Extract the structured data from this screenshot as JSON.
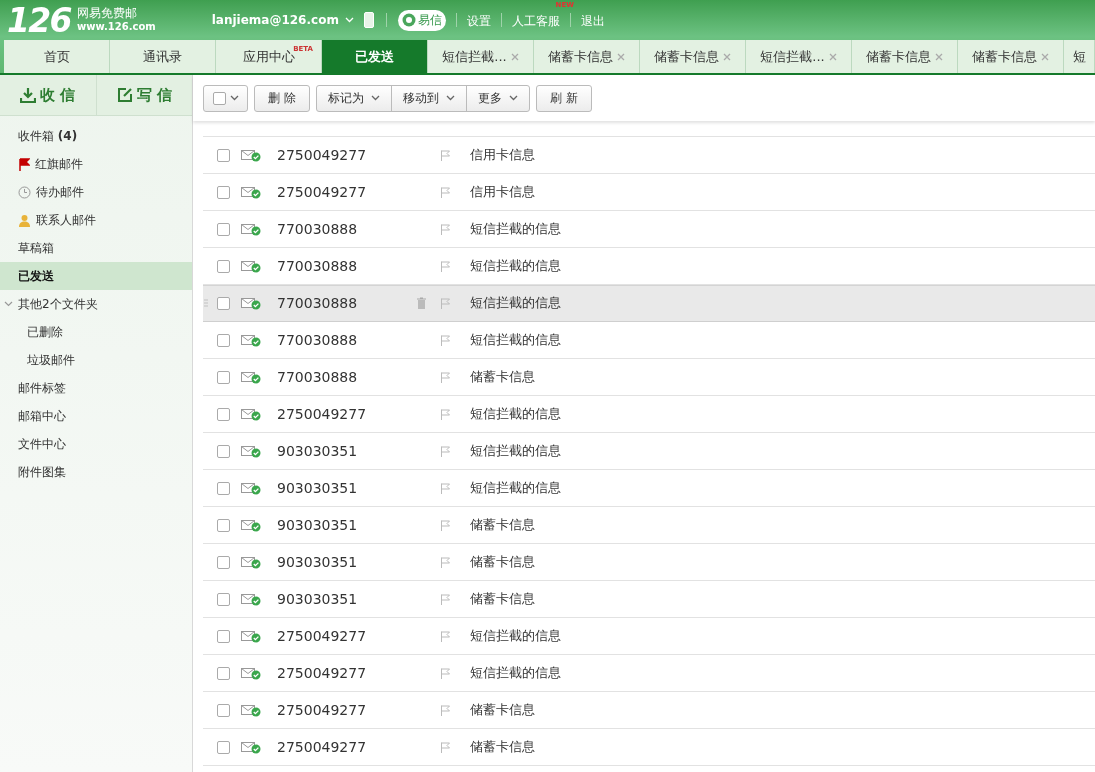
{
  "header": {
    "logo": "126",
    "brand": "网易免费邮",
    "site": "www.126.com",
    "account": "lanjiema@126.com",
    "yixin": "易信",
    "links": [
      {
        "label": "设置"
      },
      {
        "label": "人工客服",
        "badge": "NEW"
      },
      {
        "label": "退出"
      }
    ]
  },
  "tabs": [
    {
      "label": "首页",
      "closable": false,
      "selected": false
    },
    {
      "label": "通讯录",
      "closable": false,
      "selected": false
    },
    {
      "label": "应用中心",
      "badge": "BETA",
      "closable": false,
      "selected": false
    },
    {
      "label": "已发送",
      "closable": false,
      "selected": true
    },
    {
      "label": "短信拦截...",
      "closable": true,
      "selected": false
    },
    {
      "label": "储蓄卡信息",
      "closable": true,
      "selected": false
    },
    {
      "label": "储蓄卡信息",
      "closable": true,
      "selected": false
    },
    {
      "label": "短信拦截...",
      "closable": true,
      "selected": false
    },
    {
      "label": "储蓄卡信息",
      "closable": true,
      "selected": false
    },
    {
      "label": "储蓄卡信息",
      "closable": true,
      "selected": false
    },
    {
      "label": "短",
      "closable": false,
      "selected": false
    }
  ],
  "actions": {
    "receive": "收 信",
    "compose": "写 信"
  },
  "sidebar": {
    "items": [
      {
        "label": "收件箱 **(4)**",
        "kind": "plain",
        "selected": false
      },
      {
        "label": "红旗邮件",
        "kind": "flag",
        "selected": false
      },
      {
        "label": "待办邮件",
        "kind": "clock",
        "selected": false
      },
      {
        "label": "联系人邮件",
        "kind": "contact",
        "selected": false
      },
      {
        "label": "草稿箱",
        "kind": "plain",
        "selected": false
      },
      {
        "label": "已发送",
        "kind": "plain",
        "selected": true
      },
      {
        "label": "其他2个文件夹",
        "kind": "group",
        "selected": false,
        "expanded": true,
        "children": [
          {
            "label": "已删除",
            "selected": false
          },
          {
            "label": "垃圾邮件",
            "selected": false
          }
        ]
      },
      {
        "label": "邮件标签",
        "kind": "plain",
        "selected": false
      },
      {
        "label": "邮箱中心",
        "kind": "plain",
        "selected": false
      },
      {
        "label": "文件中心",
        "kind": "plain",
        "selected": false
      },
      {
        "label": "附件图集",
        "kind": "plain",
        "selected": false
      }
    ]
  },
  "toolbar": [
    {
      "label": "删 除",
      "kind": "button"
    },
    {
      "label": "标记为",
      "kind": "dropdown"
    },
    {
      "label": "移动到",
      "kind": "dropdown"
    },
    {
      "label": "更多",
      "kind": "dropdown"
    },
    {
      "label": "刷 新",
      "kind": "button"
    }
  ],
  "rows": [
    {
      "sender": "2750049277",
      "subject": "信用卡信息",
      "checked": false,
      "hovered": false
    },
    {
      "sender": "2750049277",
      "subject": "信用卡信息",
      "checked": false,
      "hovered": false
    },
    {
      "sender": "770030888",
      "subject": "短信拦截的信息",
      "checked": false,
      "hovered": false
    },
    {
      "sender": "770030888",
      "subject": "短信拦截的信息",
      "checked": false,
      "hovered": false
    },
    {
      "sender": "770030888",
      "subject": "短信拦截的信息",
      "checked": false,
      "hovered": true
    },
    {
      "sender": "770030888",
      "subject": "短信拦截的信息",
      "checked": false,
      "hovered": false
    },
    {
      "sender": "770030888",
      "subject": "储蓄卡信息",
      "checked": false,
      "hovered": false
    },
    {
      "sender": "2750049277",
      "subject": "短信拦截的信息",
      "checked": false,
      "hovered": false
    },
    {
      "sender": "903030351",
      "subject": "短信拦截的信息",
      "checked": false,
      "hovered": false
    },
    {
      "sender": "903030351",
      "subject": "短信拦截的信息",
      "checked": false,
      "hovered": false
    },
    {
      "sender": "903030351",
      "subject": "储蓄卡信息",
      "checked": false,
      "hovered": false
    },
    {
      "sender": "903030351",
      "subject": "储蓄卡信息",
      "checked": false,
      "hovered": false
    },
    {
      "sender": "903030351",
      "subject": "储蓄卡信息",
      "checked": false,
      "hovered": false
    },
    {
      "sender": "2750049277",
      "subject": "短信拦截的信息",
      "checked": false,
      "hovered": false
    },
    {
      "sender": "2750049277",
      "subject": "短信拦截的信息",
      "checked": false,
      "hovered": false
    },
    {
      "sender": "2750049277",
      "subject": "储蓄卡信息",
      "checked": false,
      "hovered": false
    },
    {
      "sender": "2750049277",
      "subject": "储蓄卡信息",
      "checked": false,
      "hovered": false
    }
  ]
}
